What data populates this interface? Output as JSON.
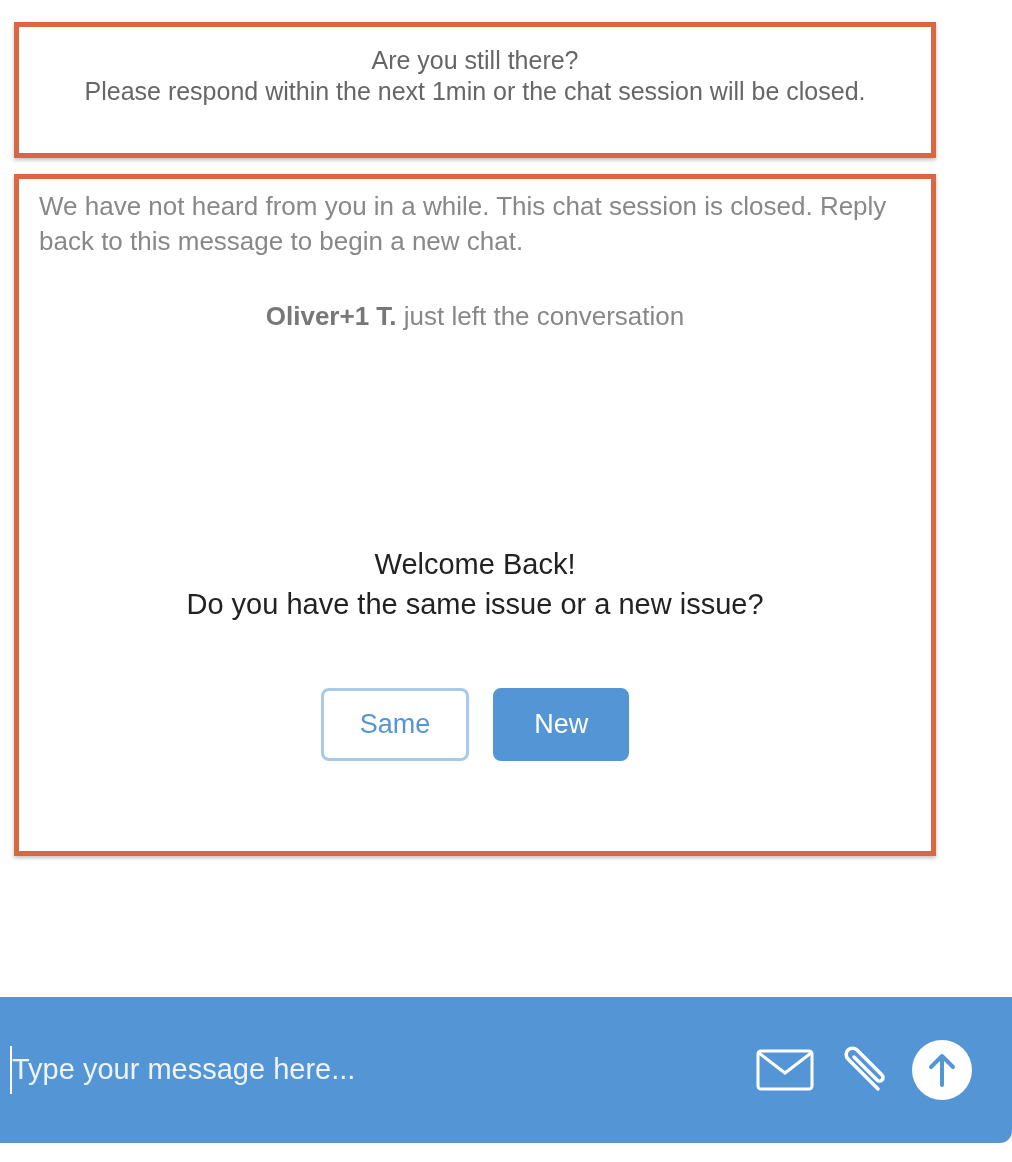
{
  "warning": {
    "highlighted": true,
    "title": "Are you still there?",
    "text": "Please respond within the next 1min or the chat session will be closed."
  },
  "conversation": {
    "highlighted": true,
    "messages": [
      {
        "kind": "system",
        "text": "We have not heard from you in a while. This chat session is closed. Reply back to this message to begin a new chat."
      },
      {
        "kind": "event",
        "text": "**Oliver+1 T.** just left the conversation"
      }
    ],
    "prompt": {
      "title": "Welcome Back!",
      "question": "Do you have the same issue or a new issue?"
    },
    "buttons": [
      {
        "label": "Same",
        "kind": "outline"
      },
      {
        "label": "New",
        "kind": "solid"
      }
    ]
  },
  "composer": {
    "placeholder": "Type your message here..."
  }
}
